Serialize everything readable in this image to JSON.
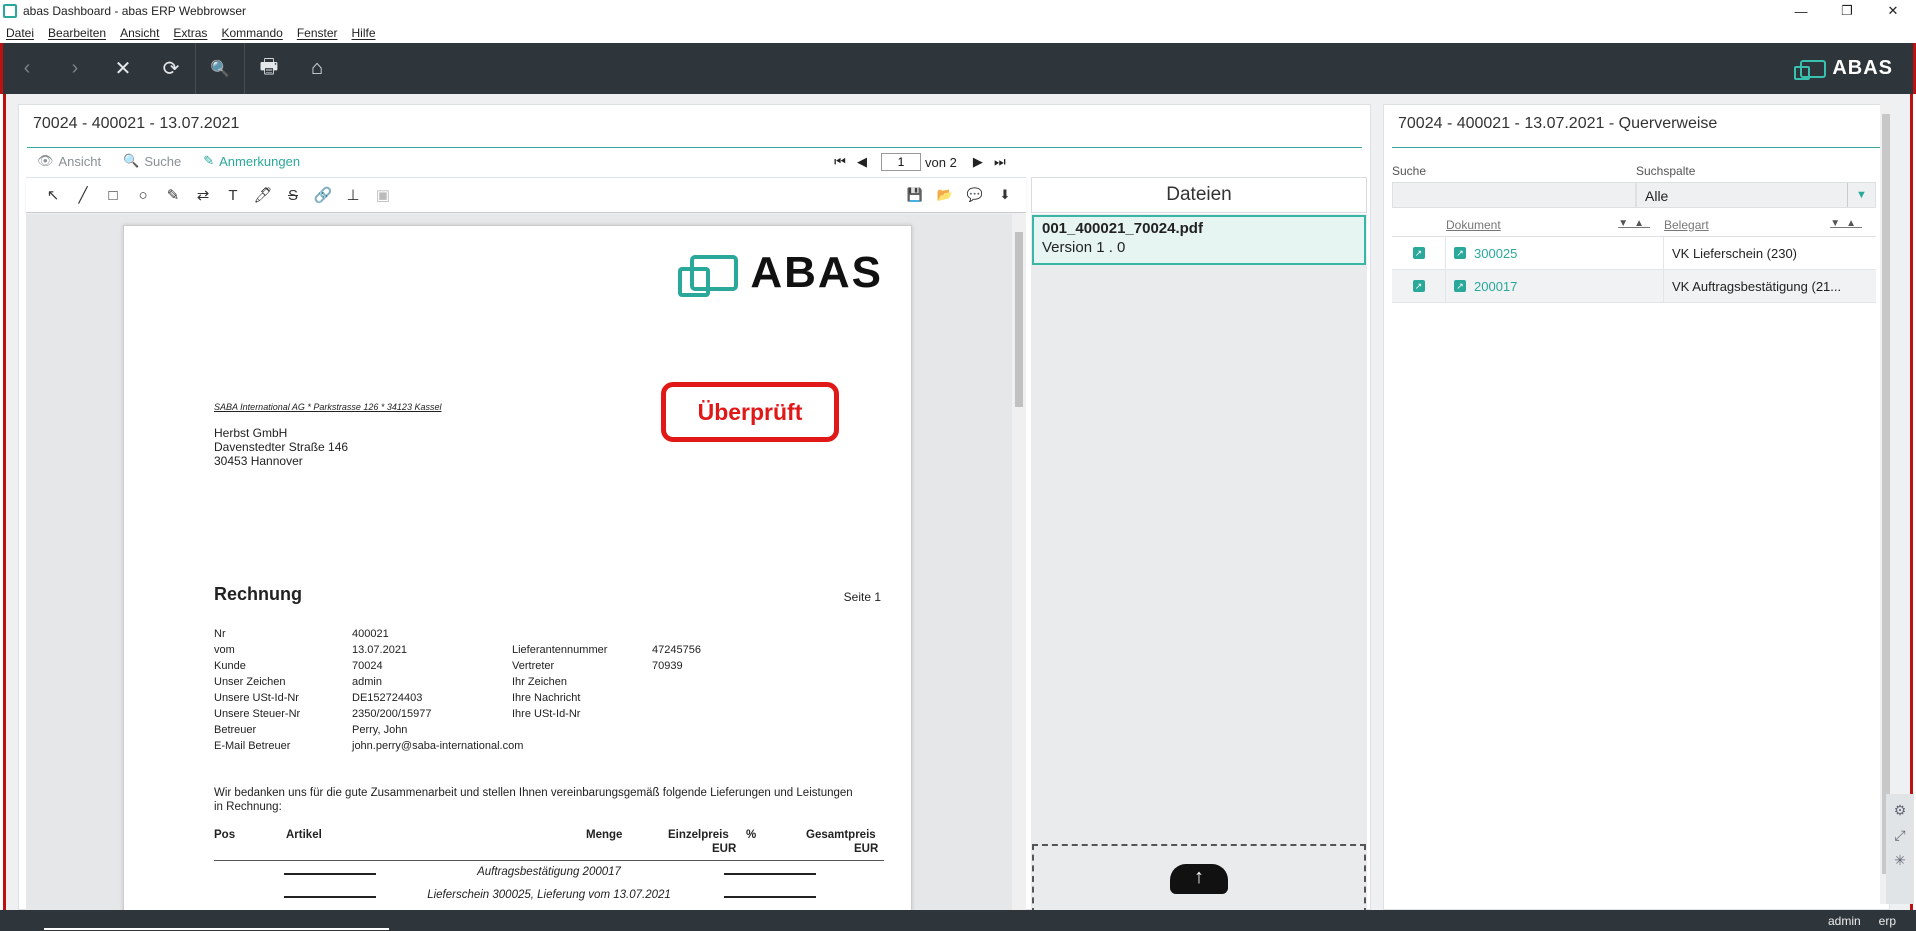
{
  "window": {
    "title": "abas Dashboard - abas ERP Webbrowser",
    "min": "—",
    "max": "❐",
    "close": "✕"
  },
  "menu": [
    "Datei",
    "Bearbeiten",
    "Ansicht",
    "Extras",
    "Kommando",
    "Fenster",
    "Hilfe"
  ],
  "toolbar": {
    "back": "‹",
    "forward": "›",
    "stop": "✕",
    "refresh": "⟳",
    "search": "🔍",
    "print": "🖶",
    "home": "⌂",
    "brand": "ABAS"
  },
  "left_panel": {
    "title": "70024 - 400021 - 13.07.2021",
    "tabs": [
      {
        "icon": "👁",
        "label": "Ansicht"
      },
      {
        "icon": "🔍",
        "label": "Suche"
      },
      {
        "icon": "✎",
        "label": "Anmerkungen"
      }
    ],
    "pager": {
      "first": "⏮",
      "prev": "◀",
      "page": "1",
      "of": "von 2",
      "next": "▶",
      "last": "⏭"
    },
    "annot_tools": [
      "↖",
      "╱",
      "□",
      "○",
      "✎",
      "⇄",
      "T",
      "🖊",
      "S",
      "🔗",
      "⊥",
      "▣"
    ],
    "annot_right": [
      "💾",
      "📂",
      "💬",
      "⬇"
    ]
  },
  "document": {
    "logo_text": "ABAS",
    "sender": "SABA International AG * Parkstrasse 126 * 34123 Kassel",
    "address": [
      "Herbst GmbH",
      "Davenstedter Straße 146",
      "30453 Hannover"
    ],
    "stamp": "Überprüft",
    "heading": "Rechnung",
    "page_label": "Seite 1",
    "meta": [
      {
        "k": "Nr",
        "v": "400021",
        "k2": "",
        "v2": ""
      },
      {
        "k": "vom",
        "v": "13.07.2021",
        "k2": "Lieferantennummer",
        "v2": "47245756"
      },
      {
        "k": "Kunde",
        "v": "70024",
        "k2": "Vertreter",
        "v2": "70939"
      },
      {
        "k": "Unser Zeichen",
        "v": "admin",
        "k2": "Ihr Zeichen",
        "v2": ""
      },
      {
        "k": "Unsere USt-Id-Nr",
        "v": "DE152724403",
        "k2": "Ihre Nachricht",
        "v2": ""
      },
      {
        "k": "Unsere Steuer-Nr",
        "v": "2350/200/15977",
        "k2": "Ihre USt-Id-Nr",
        "v2": ""
      },
      {
        "k": "Betreuer",
        "v": "Perry, John",
        "k2": "",
        "v2": ""
      },
      {
        "k": "E-Mail Betreuer",
        "v": "john.perry@saba-international.com",
        "k2": "",
        "v2": ""
      }
    ],
    "thanks": "Wir bedanken uns für die gute Zusammenarbeit und stellen Ihnen vereinbarungsgemäß folgende Lieferungen und Leistungen in Rechnung:",
    "columns": {
      "pos": "Pos",
      "artikel": "Artikel",
      "menge": "Menge",
      "einzelpreis": "Einzelpreis",
      "eur1": "EUR",
      "pct": "%",
      "gesamtpreis": "Gesamtpreis",
      "eur2": "EUR"
    },
    "sub1": "Auftragsbestätigung 200017",
    "sub2": "Lieferschein 300025, Lieferung vom 13.07.2021"
  },
  "files": {
    "title": "Dateien",
    "items": [
      {
        "name": "001_400021_70024.pdf",
        "version": "Version 1 . 0"
      }
    ]
  },
  "right_panel": {
    "title": "70024 - 400021 - 13.07.2021 - Querverweise",
    "search_label": "Suche",
    "column_label": "Suchspalte",
    "column_value": "Alle",
    "headers": {
      "doc": "Dokument",
      "type": "Belegart"
    },
    "rows": [
      {
        "doc": "300025",
        "type": "VK Lieferschein (230)"
      },
      {
        "doc": "200017",
        "type": "VK Auftragsbestätigung (21..."
      }
    ]
  },
  "status": {
    "user": "admin",
    "system": "erp"
  },
  "colors": {
    "accent": "#2aa89a",
    "toolbar": "#2e363c",
    "stamp": "#e01818"
  }
}
